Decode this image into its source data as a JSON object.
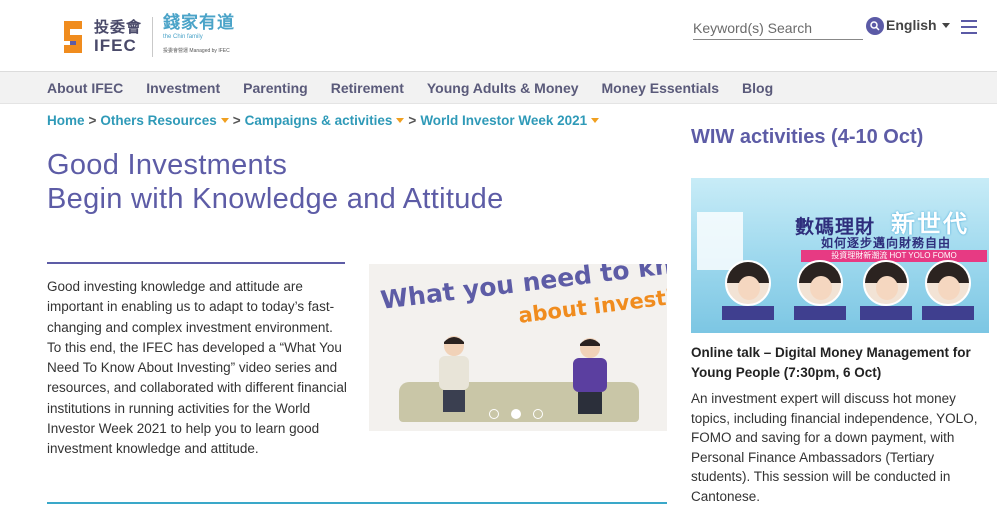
{
  "header": {
    "logo_zh": "投委會",
    "logo_en": "IFEC",
    "chin_zh": "錢家有道",
    "chin_sub": "the Chin family",
    "chin_sub2": "投委會營運 Managed by IFEC",
    "search_placeholder": "Keyword(s) Search",
    "language": "English"
  },
  "colors": {
    "brand_purple": "#5d5ca6",
    "link_teal": "#2f9ab8",
    "accent_orange": "#f0a020"
  },
  "nav": {
    "items": [
      "About IFEC",
      "Investment",
      "Parenting",
      "Retirement",
      "Young Adults & Money",
      "Money Essentials",
      "Blog"
    ]
  },
  "breadcrumb": {
    "home": "Home",
    "items": [
      "Others Resources",
      "Campaigns & activities",
      "World Investor Week 2021"
    ]
  },
  "main": {
    "title_line1": "Good Investments",
    "title_line2": "Begin with Knowledge and Attitude",
    "intro": "Good investing knowledge and attitude are important in enabling us to adapt to today’s fast-changing and complex investment environment. To this end, the IFEC has developed a “What You Need To Know About Investing” video series and resources, and collaborated with different financial institutions in running activities for the World Investor Week 2021 to help you to learn good investment knowledge and attitude.",
    "carousel": {
      "line1": "What you need to know",
      "line2": "about investing",
      "slide_count": 3,
      "active_slide": 2
    }
  },
  "sidebar": {
    "title": "WIW activities (4-10 Oct)",
    "poster": {
      "headline": "數碼理財",
      "headline2": "新世代",
      "subhead": "如何逐步邁向財務自由",
      "band": "投資理財新潮流 HOT YOLO FOMO"
    },
    "talk_title": "Online talk – Digital Money Management for Young People (7:30pm, 6 Oct)",
    "talk_desc": "An investment expert will discuss hot money topics, including financial independence, YOLO, FOMO and saving for a down payment, with Personal Finance Ambassadors (Tertiary students). This session will be conducted in Cantonese."
  }
}
